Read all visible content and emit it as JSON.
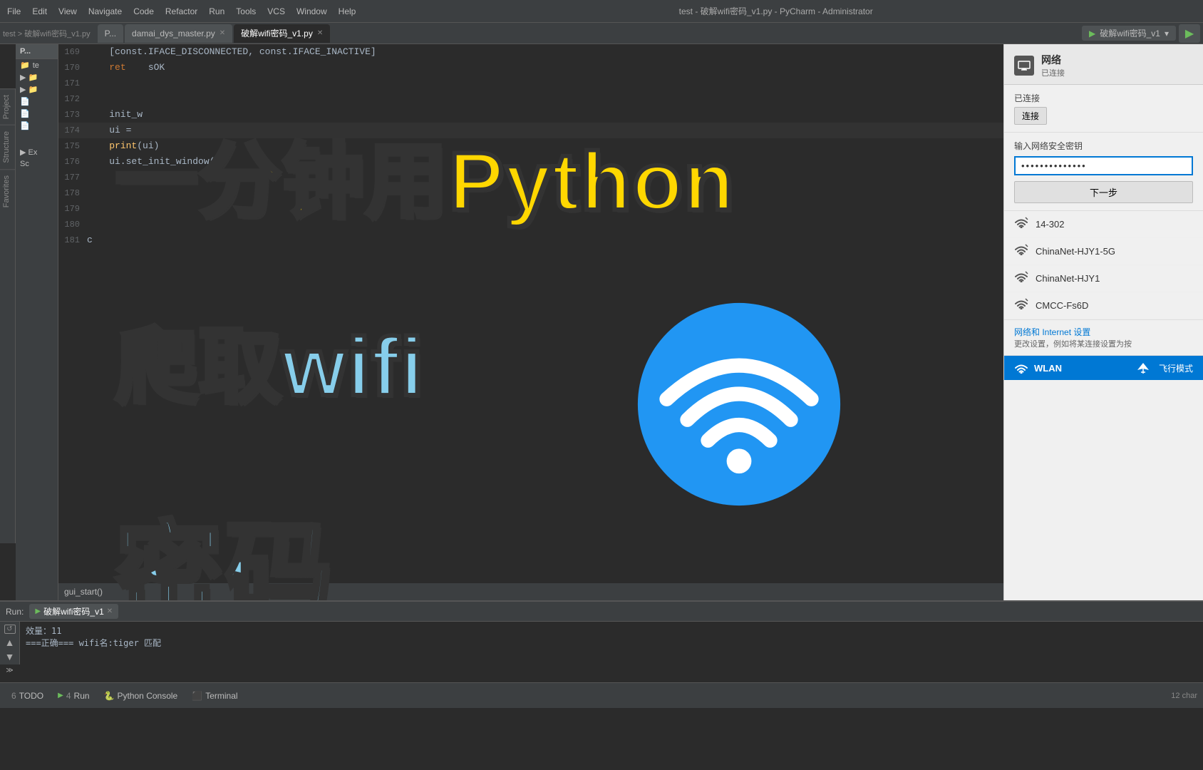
{
  "titlebar": {
    "title": "test - 破解wifi密码_v1.py - PyCharm - Administrator",
    "menu_items": [
      "File",
      "Edit",
      "View",
      "Navigate",
      "Code",
      "Refactor",
      "Run",
      "Tools",
      "VCS",
      "Window",
      "Help"
    ]
  },
  "tabbar": {
    "breadcrumb": "test > 破解wifi密码_v1.py",
    "tabs": [
      {
        "label": "P...",
        "active": false,
        "closable": false
      },
      {
        "label": "damai_dys_master.py",
        "active": false,
        "closable": true
      },
      {
        "label": "破解wifi密码_v1.py",
        "active": true,
        "closable": true
      }
    ],
    "run_config": "破解wifi密码_v1"
  },
  "editor": {
    "lines": [
      {
        "num": "169",
        "content": "    [const.IFACE_DISCONNECTED, const.IFACE_INACTIVE]",
        "highlight": false
      },
      {
        "num": "170",
        "content": "    ret    sOK",
        "highlight": false
      },
      {
        "num": "171",
        "content": "",
        "highlight": false
      },
      {
        "num": "172",
        "content": "",
        "highlight": false
      },
      {
        "num": "173",
        "content": "    init_w",
        "highlight": false
      },
      {
        "num": "174",
        "content": "    ui = ",
        "highlight": true
      },
      {
        "num": "175",
        "content": "    print(ui)",
        "highlight": false
      },
      {
        "num": "176",
        "content": "    ui.set_init_window()",
        "highlight": false
      },
      {
        "num": "177",
        "content": "",
        "highlight": false
      },
      {
        "num": "178",
        "content": "",
        "highlight": false
      },
      {
        "num": "179",
        "content": "",
        "highlight": false
      },
      {
        "num": "180",
        "content": "",
        "highlight": false
      },
      {
        "num": "181",
        "content": "c",
        "highlight": false
      }
    ],
    "bottom_line": "    gui_start()"
  },
  "overlay": {
    "line1": "一分钟用Python",
    "line2": "爬取wifi",
    "line3": "密码"
  },
  "right_panel": {
    "title": "网络",
    "subtitle": "已连接",
    "connect_text": "连接",
    "password_label": "输入网络安全密钥",
    "password_value": "••••••••••••••",
    "next_button": "下一步",
    "wifi_networks": [
      {
        "name": "14-302",
        "signal": 3
      },
      {
        "name": "ChinaNet-HJY1-5G",
        "signal": 3
      },
      {
        "name": "ChinaNet-HJY1",
        "signal": 3
      },
      {
        "name": "CMCC-Fs6D",
        "signal": 3
      }
    ],
    "network_settings": "网络和 Internet 设置",
    "network_settings_sub": "更改设置，例如将某连接设置为按",
    "wlan_label": "WLAN",
    "airplane_mode": "飞行模式"
  },
  "bottom_panel": {
    "run_label": "Run:",
    "run_config": "破解wifi密码_v1",
    "run_output_line1": "效量：11",
    "run_output_line2": "===正确===   wifi名:tiger  匹配",
    "tabs": [
      {
        "num": "6",
        "label": "TODO"
      },
      {
        "num": "4",
        "label": "Run"
      },
      {
        "label": "Python Console"
      },
      {
        "label": "Terminal"
      }
    ]
  },
  "statusbar": {
    "info": "12 char"
  }
}
